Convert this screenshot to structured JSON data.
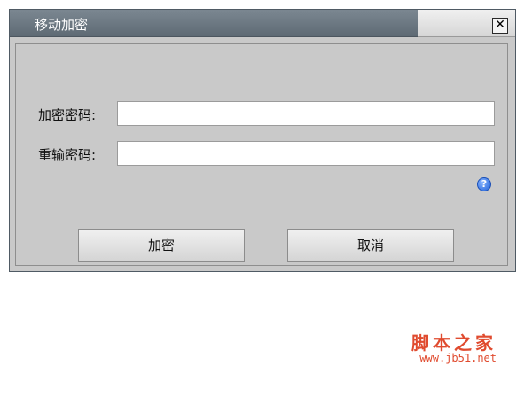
{
  "window": {
    "title": "移动加密",
    "close_glyph": "✕"
  },
  "form": {
    "password_label": "加密密码:",
    "password_value": "",
    "repeat_label": "重输密码:",
    "repeat_value": ""
  },
  "help": {
    "glyph": "?"
  },
  "buttons": {
    "encrypt": "加密",
    "cancel": "取消"
  },
  "watermark": {
    "text": "脚本之家",
    "url": "www.jb51.net"
  },
  "colors": {
    "titlebar": "#6b7781",
    "dialog_bg": "#c9c9c9",
    "watermark": "#e04b2f",
    "help": "#1e5fd8"
  }
}
